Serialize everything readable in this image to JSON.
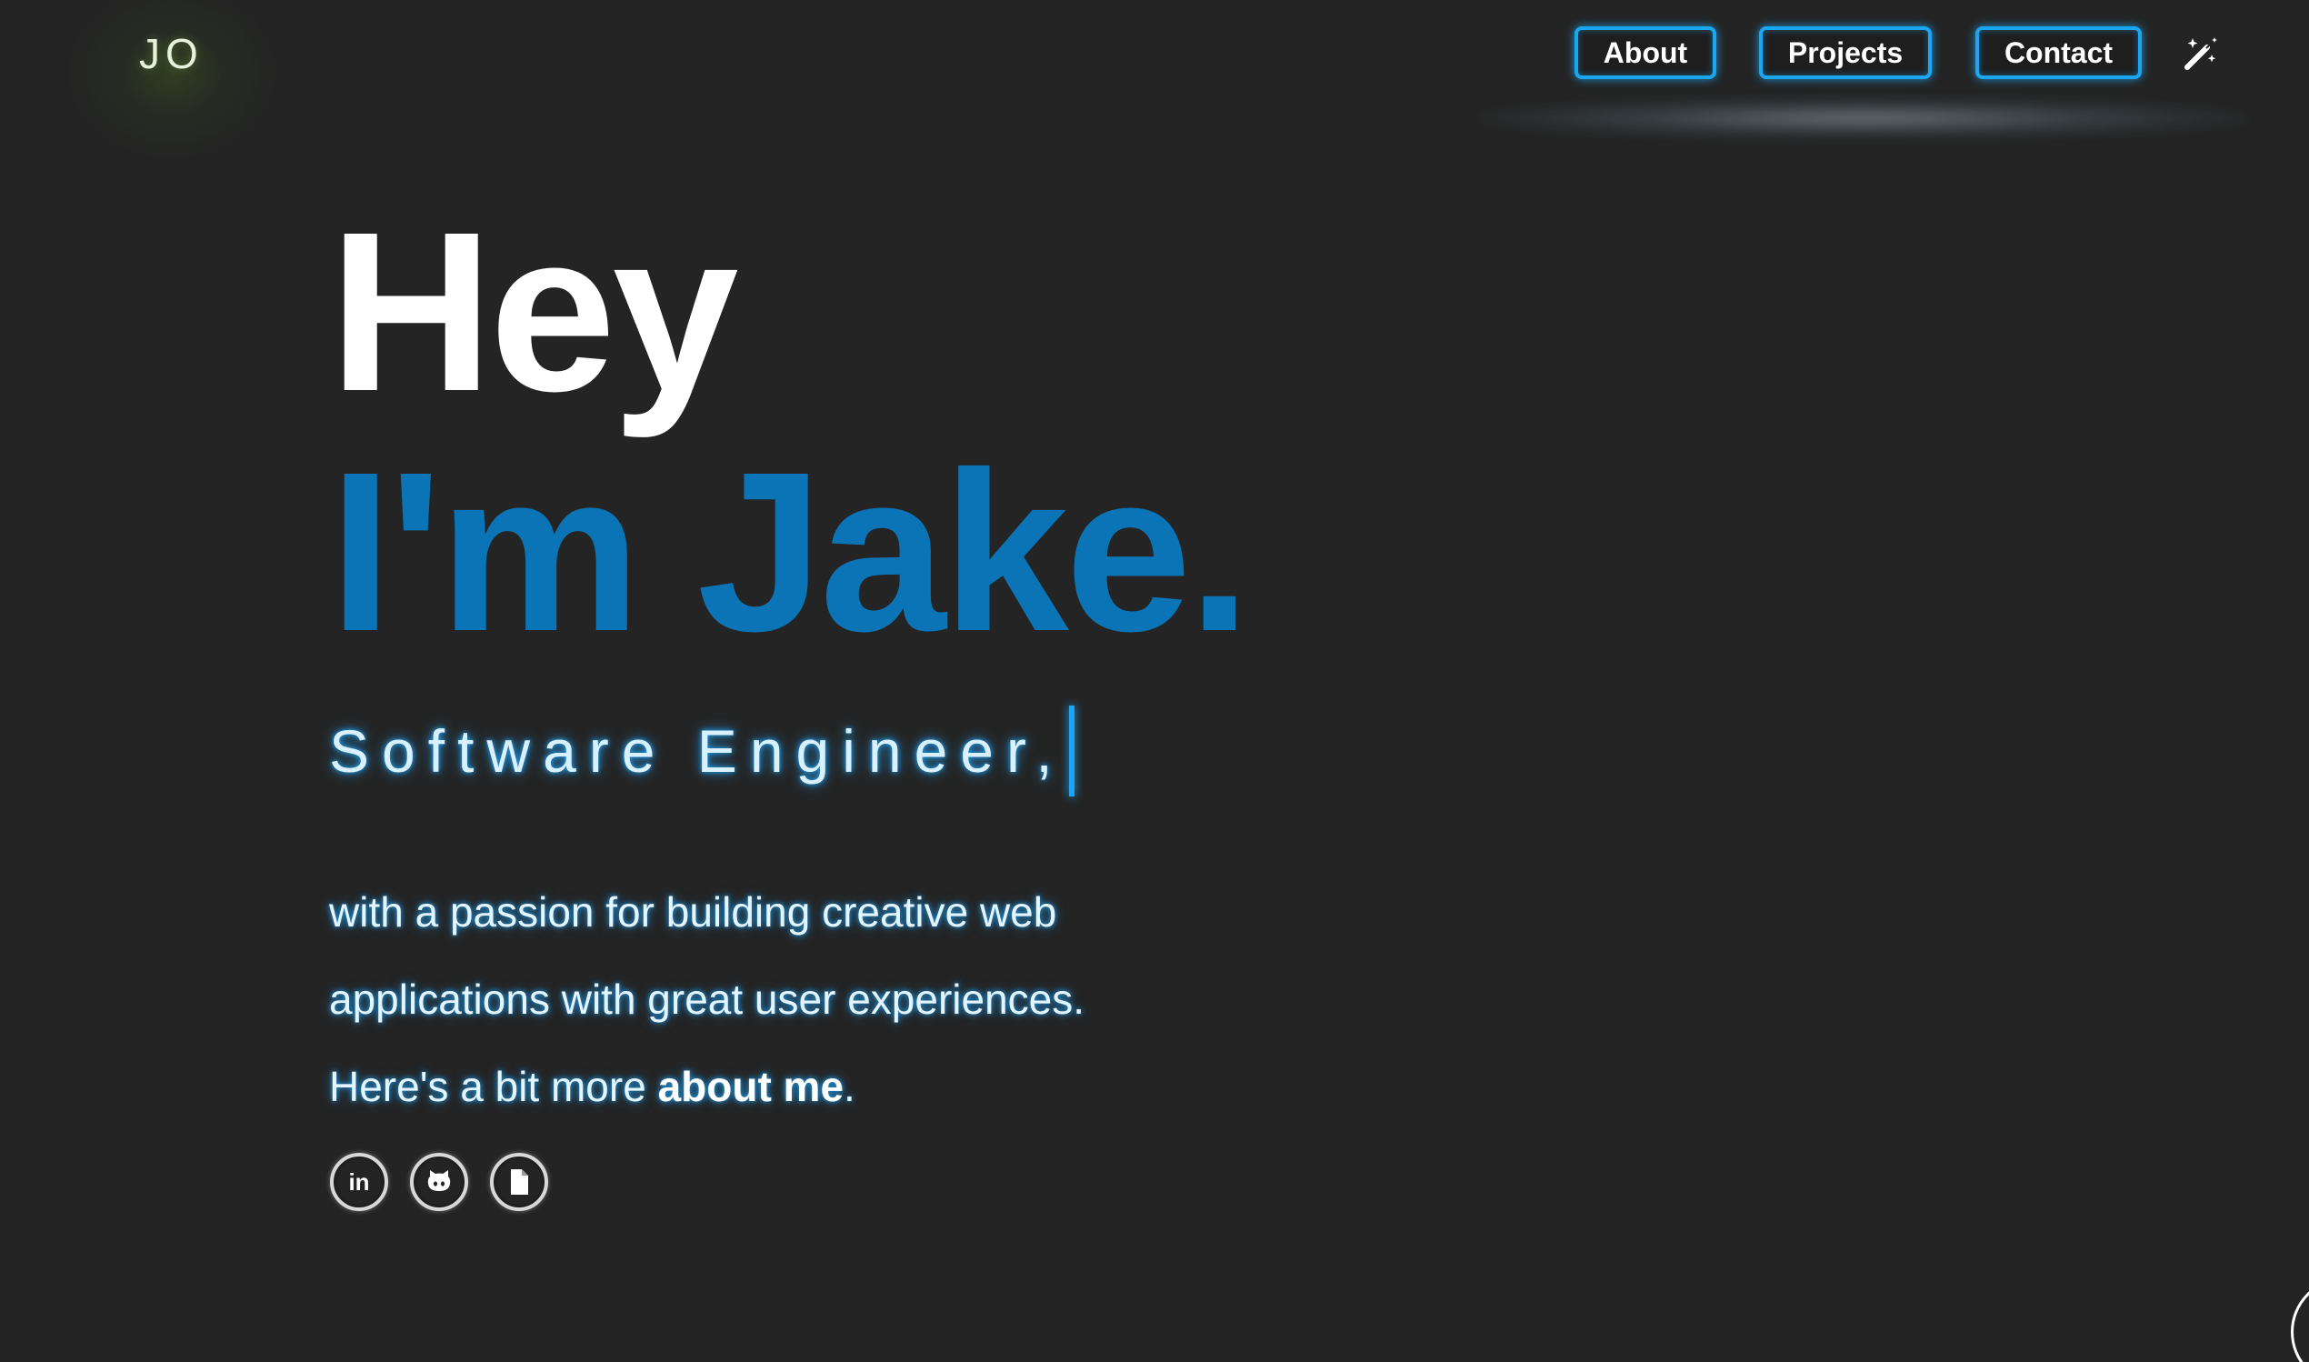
{
  "header": {
    "logo": "JO",
    "nav": {
      "about_label": "About",
      "projects_label": "Projects",
      "contact_label": "Contact"
    },
    "theme_toggle_icon": "magic-wand-icon"
  },
  "hero": {
    "greeting": "Hey",
    "name": "I'm Jake.",
    "role": "Software Engineer,",
    "bio_line_1": "with a passion for building creative web",
    "bio_line_2": "applications with great user experiences.",
    "bio_line_3_prefix": "Here's a bit more ",
    "bio_link": "about me",
    "bio_line_3_suffix": "."
  },
  "social": {
    "linkedin_icon": "linkedin-icon",
    "linkedin_text": "in",
    "github_icon": "github-icon",
    "resume_icon": "document-icon"
  },
  "colors": {
    "background": "#242424",
    "accent_blue": "#0a74b6",
    "neon_blue": "#1ba6f2",
    "text_white": "#ffffff"
  }
}
